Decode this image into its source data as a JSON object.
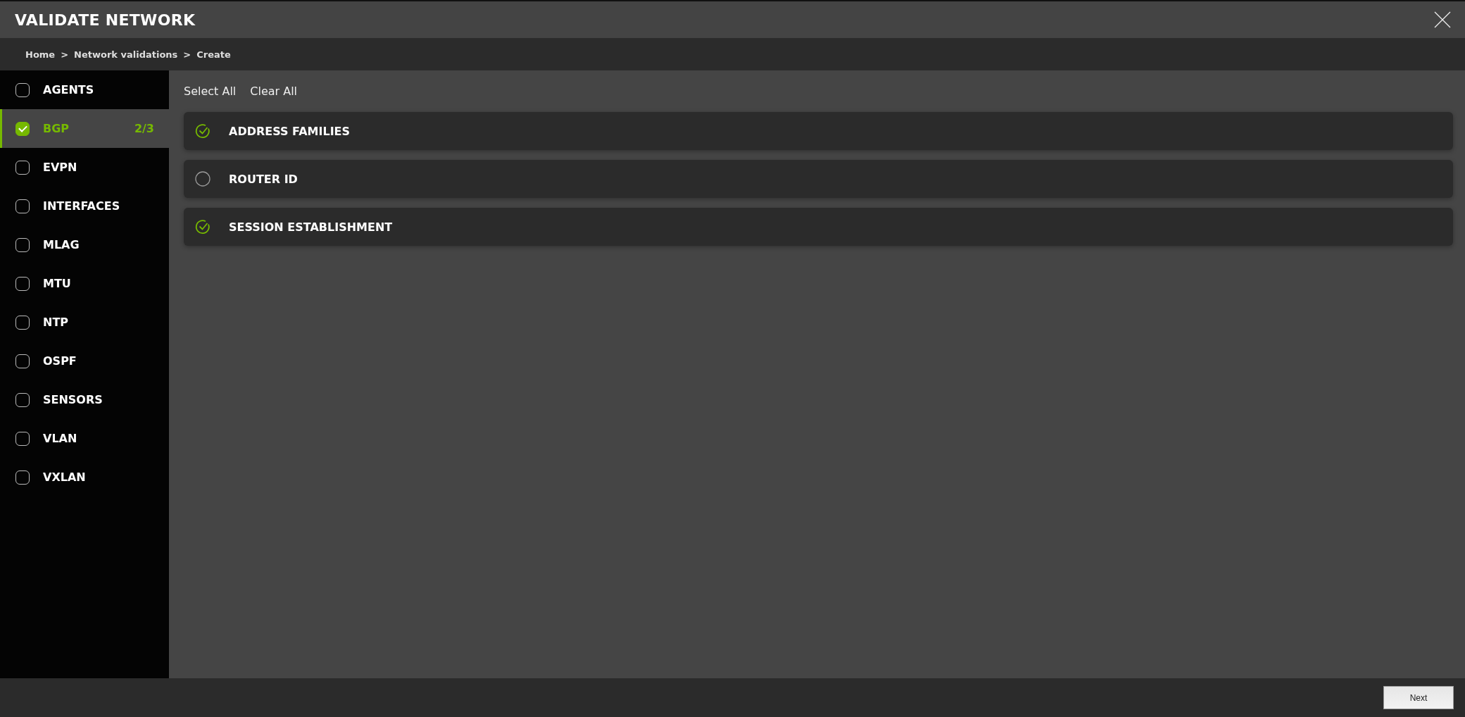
{
  "window": {
    "title": "VALIDATE NETWORK"
  },
  "breadcrumb": [
    "Home",
    "Network validations",
    "Create"
  ],
  "breadcrumb_separator": ">",
  "sidebar": {
    "items": [
      {
        "label": "AGENTS",
        "checked": false,
        "selected": false
      },
      {
        "label": "BGP",
        "checked": true,
        "selected": true,
        "count": "2/3"
      },
      {
        "label": "EVPN",
        "checked": false,
        "selected": false
      },
      {
        "label": "INTERFACES",
        "checked": false,
        "selected": false
      },
      {
        "label": "MLAG",
        "checked": false,
        "selected": false
      },
      {
        "label": "MTU",
        "checked": false,
        "selected": false
      },
      {
        "label": "NTP",
        "checked": false,
        "selected": false
      },
      {
        "label": "OSPF",
        "checked": false,
        "selected": false
      },
      {
        "label": "SENSORS",
        "checked": false,
        "selected": false
      },
      {
        "label": "VLAN",
        "checked": false,
        "selected": false
      },
      {
        "label": "VXLAN",
        "checked": false,
        "selected": false
      }
    ]
  },
  "actions": [
    "Select All",
    "Clear All"
  ],
  "tests": [
    {
      "label": "ADDRESS FAMILIES",
      "checked": true
    },
    {
      "label": "ROUTER ID",
      "checked": false
    },
    {
      "label": "SESSION ESTABLISHMENT",
      "checked": true
    }
  ],
  "footer": {
    "button": "Next"
  }
}
